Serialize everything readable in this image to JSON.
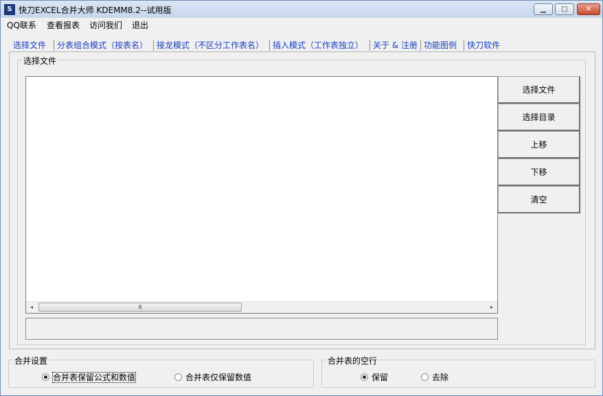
{
  "window": {
    "icon_glyph": "S",
    "title": "快刀EXCEL合并大师 KDEMM8.2--试用版",
    "min_glyph": "▁",
    "max_glyph": "□",
    "close_glyph": "✕"
  },
  "menu": [
    "QQ联系",
    "查看报表",
    "访问我们",
    "退出"
  ],
  "tabs": [
    "选择文件",
    "分表组合模式（按表名）",
    "接龙模式（不区分工作表名）",
    "插入模式（工作表独立）",
    "关于 & 注册",
    "功能图例",
    "快刀软件"
  ],
  "active_tab": 0,
  "file_group": {
    "label": "选择文件",
    "scroll_left": "◂",
    "scroll_right": "▸",
    "scroll_grip": "Ⅲ",
    "buttons": [
      "选择文件",
      "选择目录",
      "上移",
      "下移",
      "清空"
    ]
  },
  "merge_settings": {
    "label": "合并设置",
    "options": [
      "合并表保留公式和数值",
      "合并表仅保留数值"
    ],
    "selected": 0
  },
  "blank_rows": {
    "label": "合并表的空行",
    "options": [
      "保留",
      "去除"
    ],
    "selected": 0
  },
  "icons": [
    "app-icon",
    "minimize-icon",
    "maximize-icon",
    "close-icon",
    "scroll-left-icon",
    "scroll-right-icon",
    "scroll-grip-icon"
  ]
}
